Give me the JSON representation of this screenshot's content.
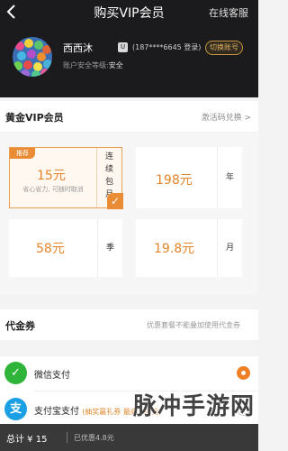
{
  "header": {
    "title": "购买VIP会员",
    "service": "在线客服"
  },
  "profile": {
    "name": "西西沐",
    "account_icon_text": "U",
    "account": "(187****6645 登录)",
    "switch_label": "切换账号",
    "security_label": "账户安全等级:",
    "security_level": "安全"
  },
  "vip": {
    "title": "黄金VIP会员",
    "redeem": "激活码兑换 >"
  },
  "plans": [
    {
      "price": "15元",
      "side": "连续包月",
      "tag": "推荐",
      "subtitle": "省心省力, 可随时取消",
      "selected": true
    },
    {
      "price": "198元",
      "side": "年",
      "selected": false
    },
    {
      "price": "58元",
      "side": "季",
      "selected": false
    },
    {
      "price": "19.8元",
      "side": "月",
      "selected": false
    }
  ],
  "coupon": {
    "title": "代金券",
    "note": "优惠套餐不能叠加使用代金券"
  },
  "payments": [
    {
      "label": "微信支付",
      "promo": "",
      "icon": "wechat-pay-icon",
      "selected": true
    },
    {
      "label": "支付宝支付",
      "promo": "(抽奖赢礼券 最高188元)",
      "icon": "alipay-icon",
      "selected": false
    }
  ],
  "bottom": {
    "total": "总计 ¥ 15",
    "discount": "已优惠4.8元"
  },
  "watermark": "脉冲手游网",
  "colors": {
    "accent": "#ea8c35",
    "header_bg": "#1b1b1d",
    "wechat": "#2fb43a",
    "alipay": "#1a9fe5"
  }
}
